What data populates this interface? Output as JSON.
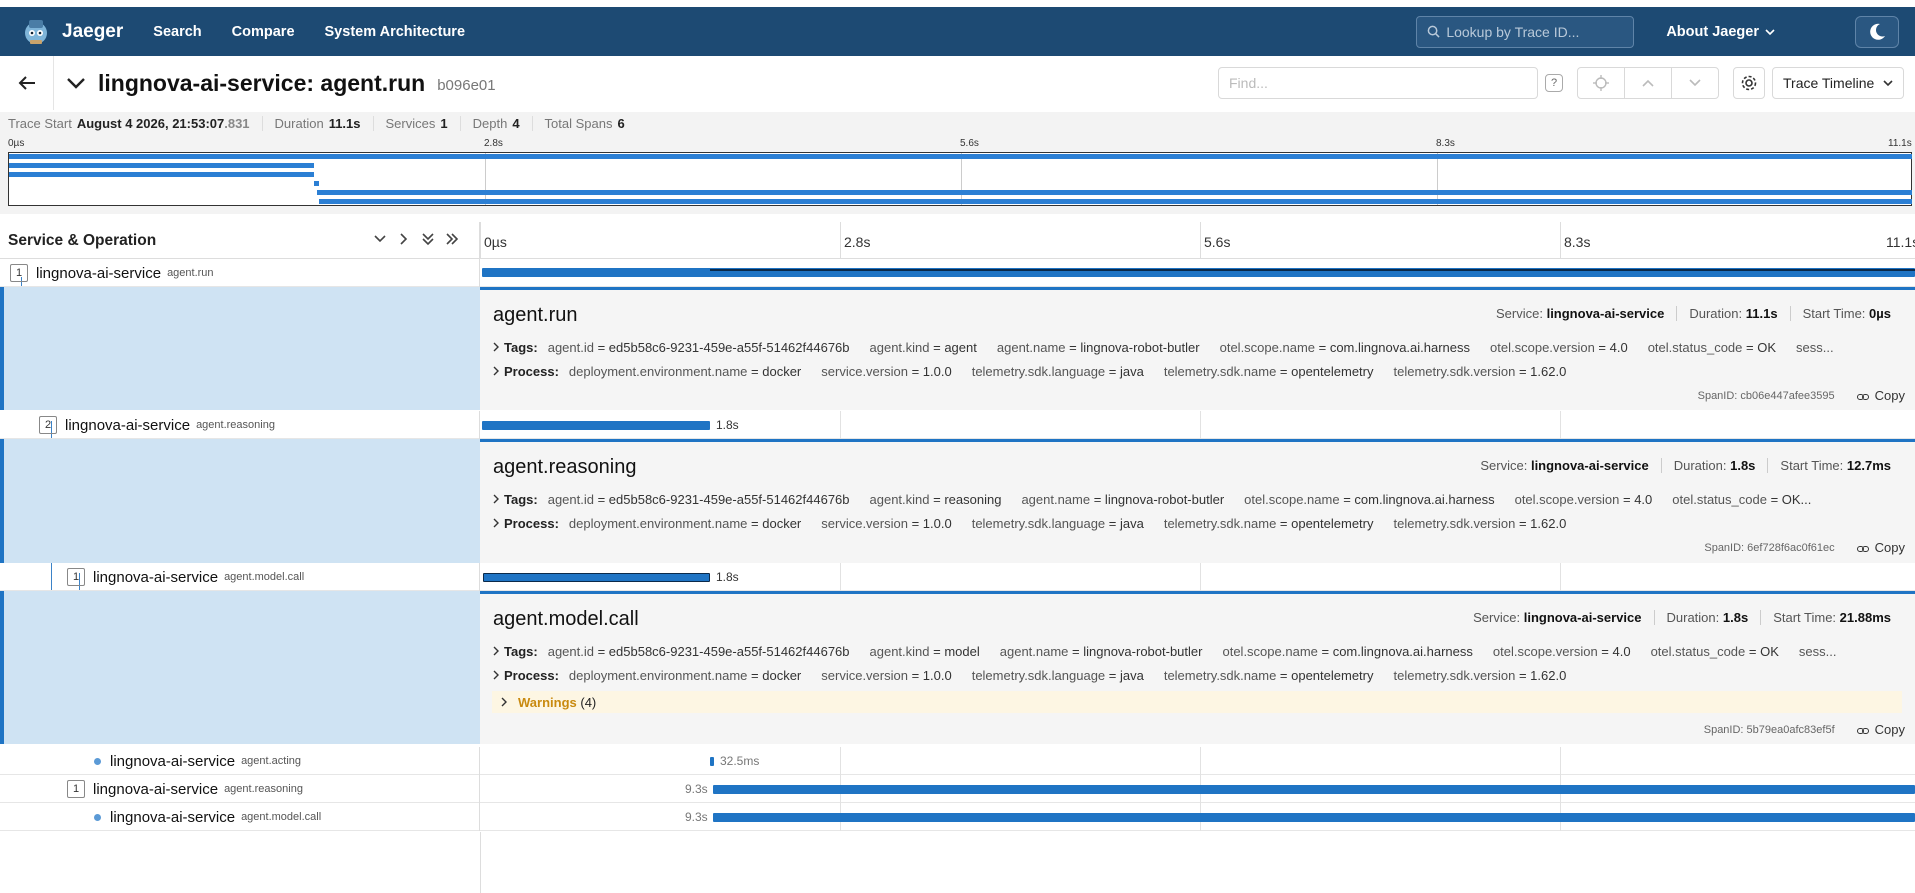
{
  "nav": {
    "brand": "Jaeger",
    "links": [
      "Search",
      "Compare",
      "System Architecture"
    ],
    "lookup_placeholder": "Lookup by Trace ID...",
    "about": "About Jaeger"
  },
  "header": {
    "title": "lingnova-ai-service: agent.run",
    "trace_id": "b096e01",
    "find_placeholder": "Find...",
    "view": "Trace Timeline"
  },
  "summary": {
    "trace_start_label": "Trace Start",
    "trace_start_date": "August 4 2026, 21:53:07",
    "trace_start_ms": ".831",
    "duration_label": "Duration",
    "duration": "11.1s",
    "services_label": "Services",
    "services": "1",
    "depth_label": "Depth",
    "depth": "4",
    "total_spans_label": "Total Spans",
    "total_spans": "6"
  },
  "minimap": {
    "ticks": [
      "0µs",
      "2.8s",
      "5.6s",
      "8.3s",
      "11.1s"
    ]
  },
  "timeline": {
    "left_title": "Service & Operation",
    "ticks": [
      "0µs",
      "2.8s",
      "5.6s",
      "8.3s",
      "11.1s"
    ]
  },
  "spans": [
    {
      "count": "1",
      "service": "lingnova-ai-service",
      "operation": "agent.run",
      "duration_label": ""
    },
    {
      "count": "2",
      "service": "lingnova-ai-service",
      "operation": "agent.reasoning",
      "duration_label": "1.8s"
    },
    {
      "count": "1",
      "service": "lingnova-ai-service",
      "operation": "agent.model.call",
      "duration_label": "1.8s"
    },
    {
      "count": "",
      "service": "lingnova-ai-service",
      "operation": "agent.acting",
      "duration_label": "32.5ms"
    },
    {
      "count": "1",
      "service": "lingnova-ai-service",
      "operation": "agent.reasoning",
      "duration_label": "9.3s"
    },
    {
      "count": "",
      "service": "lingnova-ai-service",
      "operation": "agent.model.call",
      "duration_label": "9.3s"
    }
  ],
  "labels": {
    "service": "Service:",
    "duration": "Duration:",
    "start_time": "Start Time:",
    "tags": "Tags:",
    "process": "Process:",
    "spanid": "SpanID:",
    "copy": "Copy",
    "warnings": "Warnings",
    "eq": " = "
  },
  "details": [
    {
      "title": "agent.run",
      "service": "lingnova-ai-service",
      "duration": "11.1s",
      "start": "0µs",
      "tags": [
        [
          "agent.id",
          "ed5b58c6-9231-459e-a55f-51462f44676b"
        ],
        [
          "agent.kind",
          "agent"
        ],
        [
          "agent.name",
          "lingnova-robot-butler"
        ],
        [
          "otel.scope.name",
          "com.lingnova.ai.harness"
        ],
        [
          "otel.scope.version",
          "4.0"
        ],
        [
          "otel.status_code",
          "OK"
        ],
        [
          "sess...",
          ""
        ]
      ],
      "process": [
        [
          "deployment.environment.name",
          "docker"
        ],
        [
          "service.version",
          "1.0.0"
        ],
        [
          "telemetry.sdk.language",
          "java"
        ],
        [
          "telemetry.sdk.name",
          "opentelemetry"
        ],
        [
          "telemetry.sdk.version",
          "1.62.0"
        ]
      ],
      "spanid": "cb06e447afee3595"
    },
    {
      "title": "agent.reasoning",
      "service": "lingnova-ai-service",
      "duration": "1.8s",
      "start": "12.7ms",
      "tags": [
        [
          "agent.id",
          "ed5b58c6-9231-459e-a55f-51462f44676b"
        ],
        [
          "agent.kind",
          "reasoning"
        ],
        [
          "agent.name",
          "lingnova-robot-butler"
        ],
        [
          "otel.scope.name",
          "com.lingnova.ai.harness"
        ],
        [
          "otel.scope.version",
          "4.0"
        ],
        [
          "otel.status_code",
          "OK..."
        ]
      ],
      "process": [
        [
          "deployment.environment.name",
          "docker"
        ],
        [
          "service.version",
          "1.0.0"
        ],
        [
          "telemetry.sdk.language",
          "java"
        ],
        [
          "telemetry.sdk.name",
          "opentelemetry"
        ],
        [
          "telemetry.sdk.version",
          "1.62.0"
        ]
      ],
      "spanid": "6ef728f6ac0f61ec"
    },
    {
      "title": "agent.model.call",
      "service": "lingnova-ai-service",
      "duration": "1.8s",
      "start": "21.88ms",
      "tags": [
        [
          "agent.id",
          "ed5b58c6-9231-459e-a55f-51462f44676b"
        ],
        [
          "agent.kind",
          "model"
        ],
        [
          "agent.name",
          "lingnova-robot-butler"
        ],
        [
          "otel.scope.name",
          "com.lingnova.ai.harness"
        ],
        [
          "otel.scope.version",
          "4.0"
        ],
        [
          "otel.status_code",
          "OK"
        ],
        [
          "sess...",
          ""
        ]
      ],
      "process": [
        [
          "deployment.environment.name",
          "docker"
        ],
        [
          "service.version",
          "1.0.0"
        ],
        [
          "telemetry.sdk.language",
          "java"
        ],
        [
          "telemetry.sdk.name",
          "opentelemetry"
        ],
        [
          "telemetry.sdk.version",
          "1.62.0"
        ]
      ],
      "warnings_count": "(4)",
      "spanid": "5b79ea0afc83ef5f"
    }
  ]
}
